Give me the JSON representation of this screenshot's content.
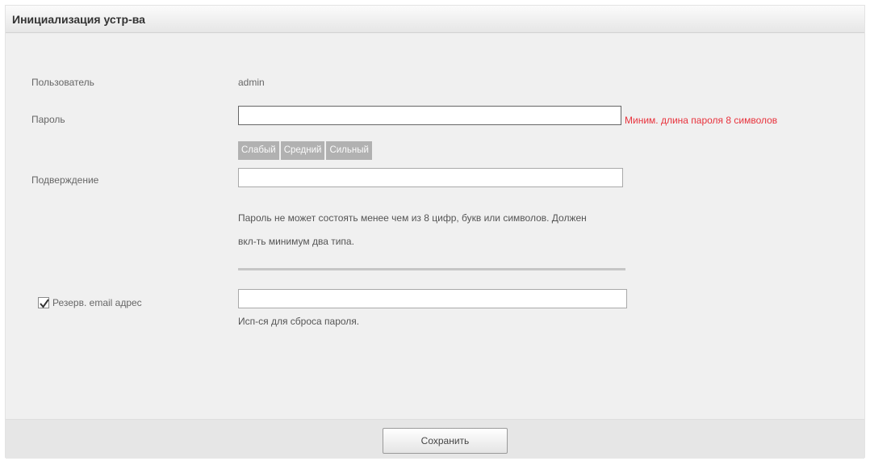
{
  "dialog": {
    "title": "Инициализация устр-ва"
  },
  "form": {
    "user_label": "Пользователь",
    "user_value": "admin",
    "password_label": "Пароль",
    "password_value": "",
    "password_error": "Миним. длина пароля 8 символов",
    "strength": [
      "Слабый",
      "Средний",
      "Сильный"
    ],
    "confirm_label": "Подверждение",
    "confirm_value": "",
    "hint_line1": "Пароль не может состоять менее чем из 8 цифр, букв или символов. Должен",
    "hint_line2": "вкл-ть минимум два типа.",
    "email_checked": true,
    "email_label": "Резерв. email адрес",
    "email_value": "",
    "email_note": "Исп-ся для сброса пароля."
  },
  "footer": {
    "save_label": "Сохранить"
  }
}
